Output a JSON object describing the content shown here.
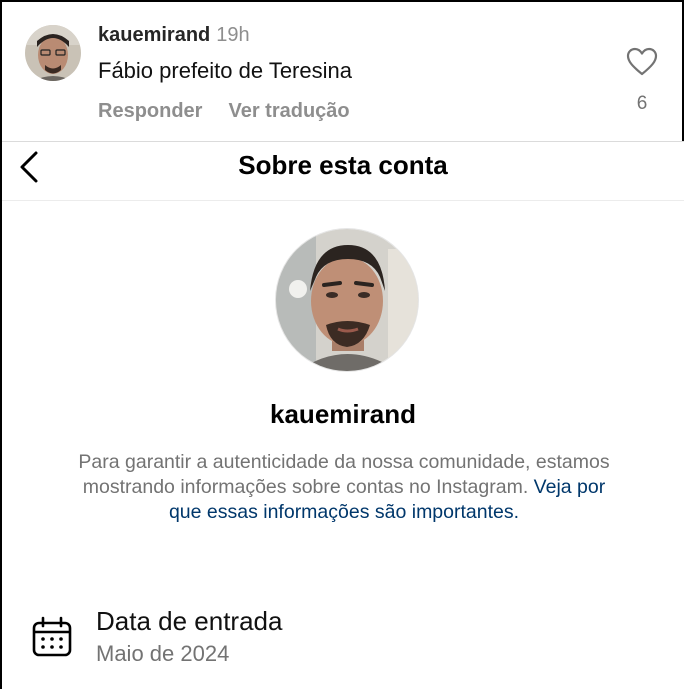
{
  "comment": {
    "username": "kauemirand",
    "time": "19h",
    "text": "Fábio prefeito de Teresina",
    "reply_label": "Responder",
    "translate_label": "Ver tradução",
    "like_count": "6",
    "icons": {
      "like": "heart-outline-icon",
      "avatar": "profile-photo"
    }
  },
  "about": {
    "title": "Sobre esta conta",
    "back_icon": "chevron-left-icon",
    "username": "kauemirand",
    "description": "Para garantir a autenticidade da nossa comunidade, estamos mostrando informações sobre contas no Instagram.",
    "link_text": "Veja por que essas informações são importantes.",
    "join_label": "Data de entrada",
    "join_value": "Maio de 2024",
    "join_icon": "calendar-icon"
  },
  "colors": {
    "link": "#00376b",
    "muted": "#737373",
    "meta": "#8e8e8e"
  }
}
